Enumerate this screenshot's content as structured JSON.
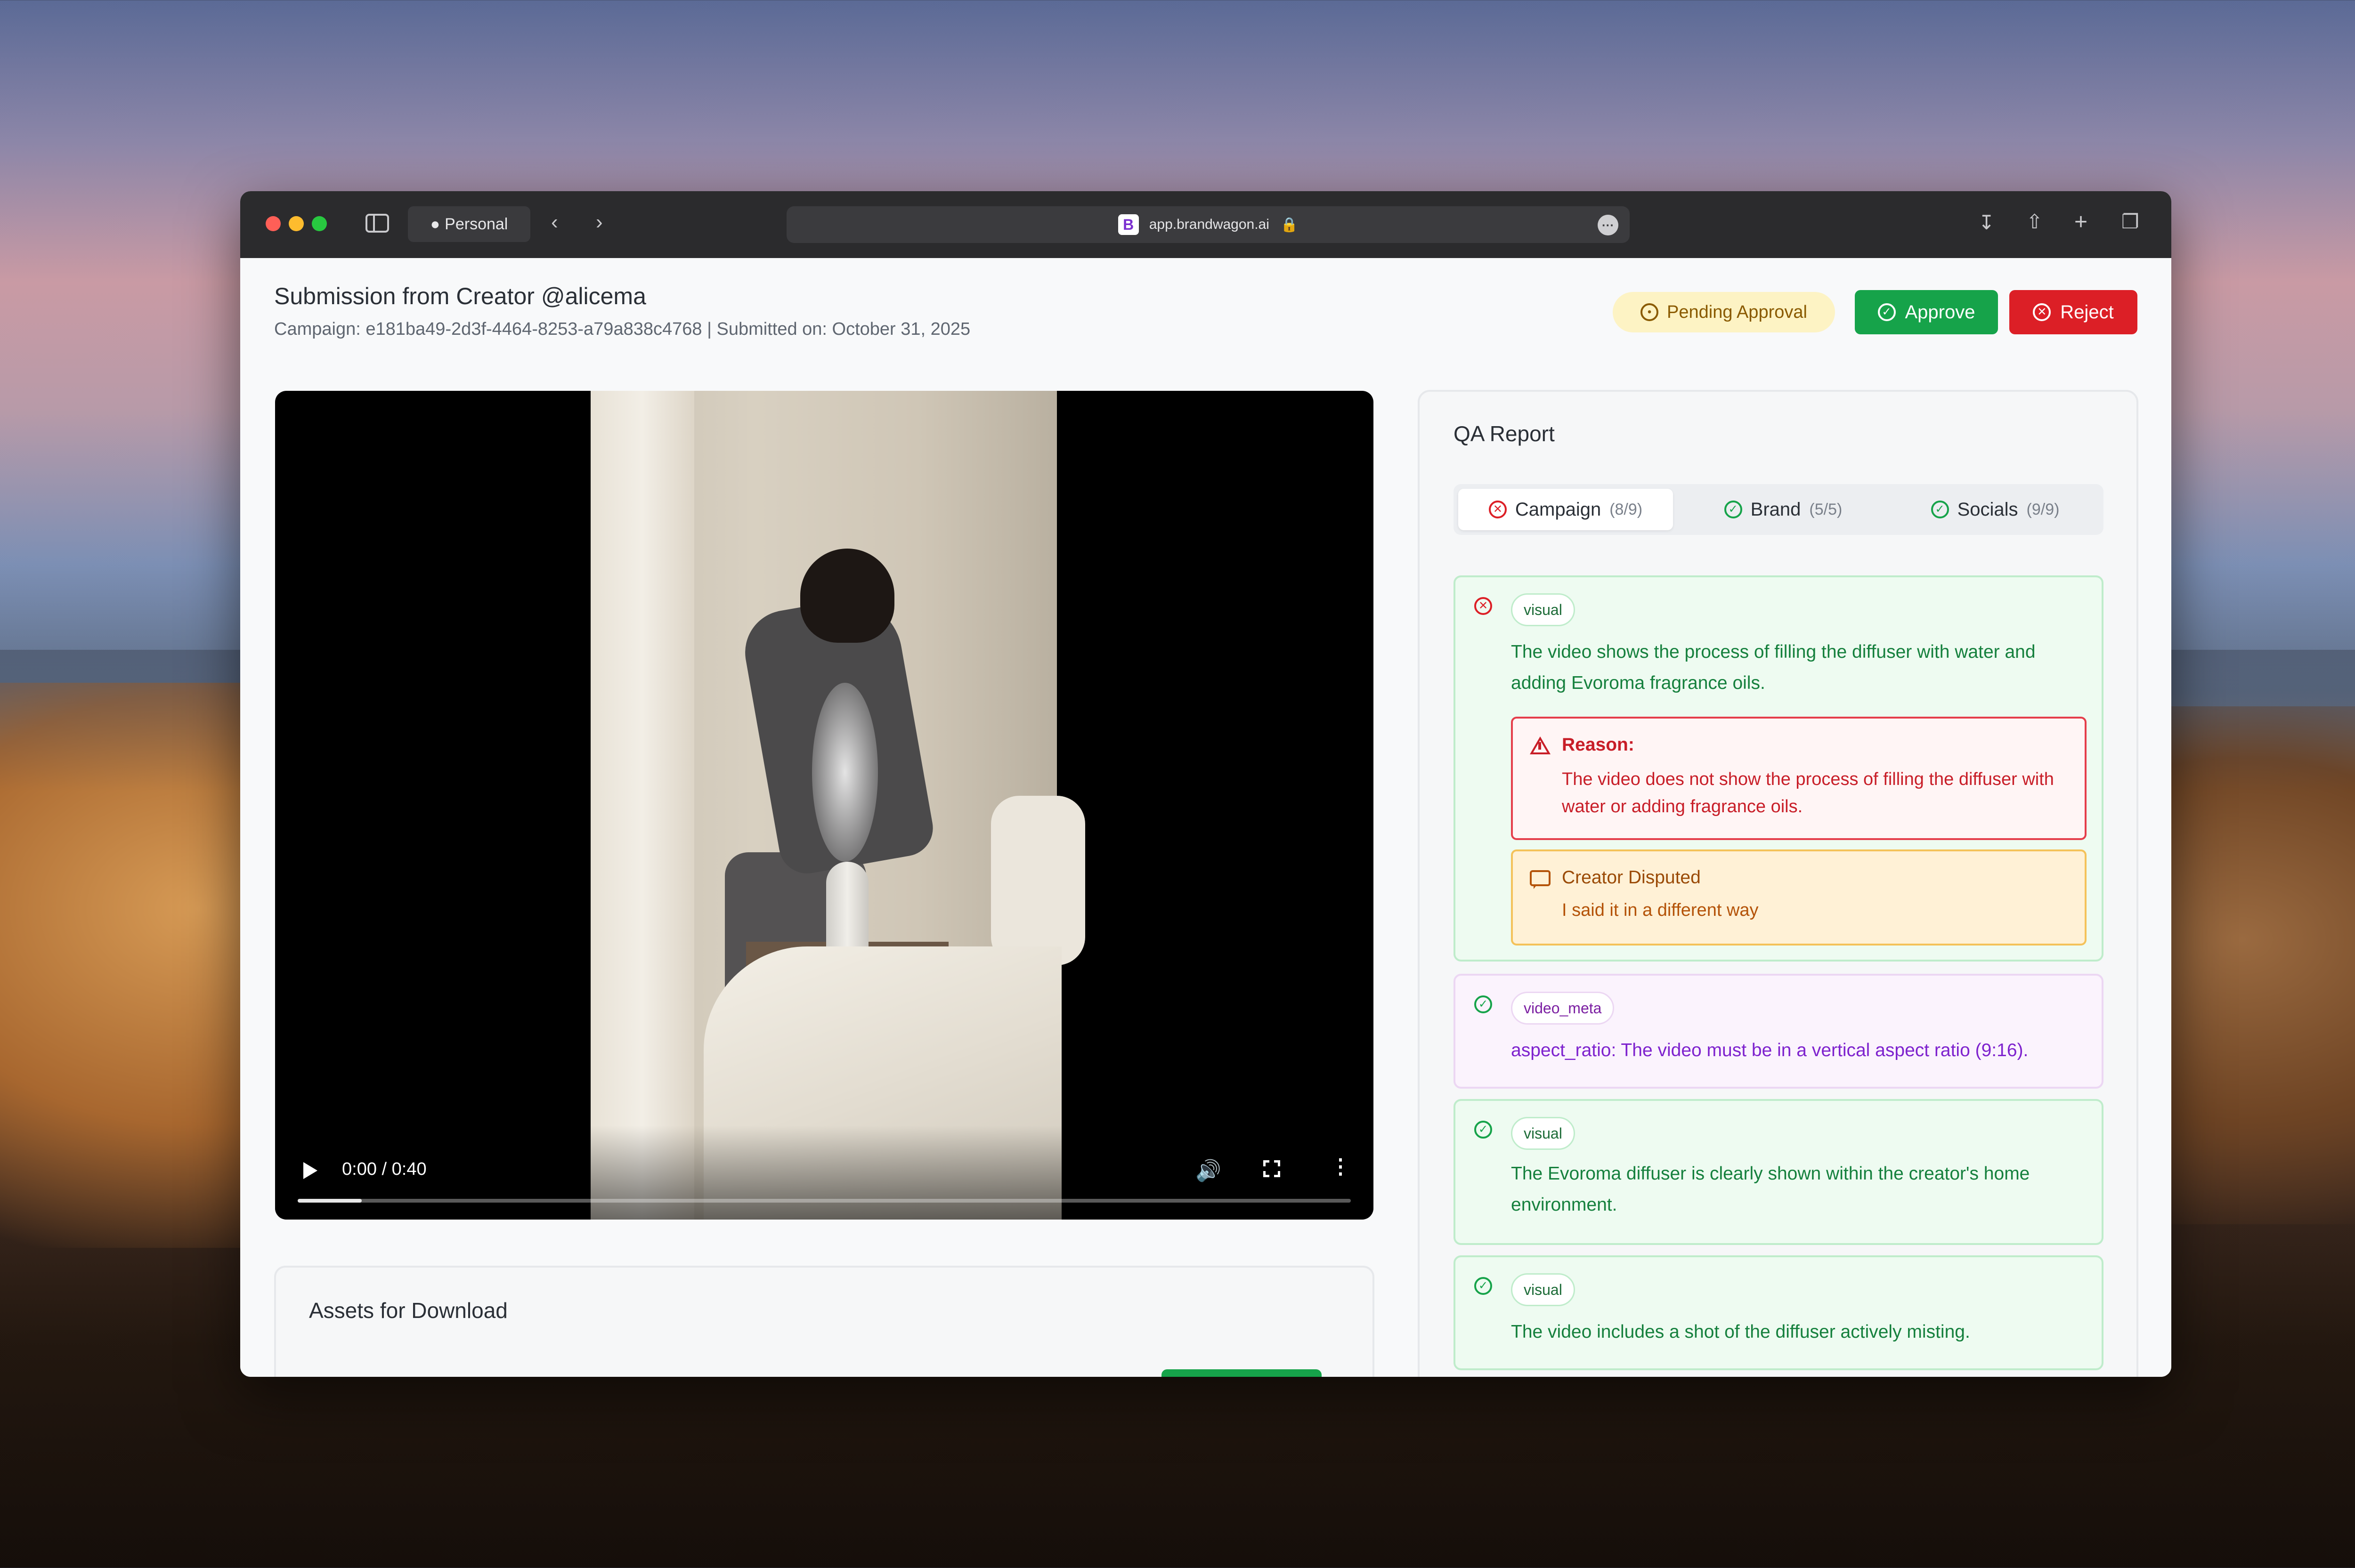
{
  "browser": {
    "profile_label": "Personal",
    "url": "app.brandwagon.ai",
    "favicon_letter": "B"
  },
  "header": {
    "title": "Submission from Creator @alicema",
    "subtitle": "Campaign: e181ba49-2d3f-4464-8253-a79a838c4768 | Submitted on: October 31, 2025",
    "status_badge": "Pending Approval",
    "approve_label": "Approve",
    "reject_label": "Reject"
  },
  "video": {
    "time": "0:00 / 0:40",
    "progress": 0.0
  },
  "assets": {
    "title": "Assets for Download"
  },
  "qa": {
    "title": "QA Report",
    "tabs": [
      {
        "label": "Campaign",
        "count": "(8/9)",
        "status": "fail"
      },
      {
        "label": "Brand",
        "count": "(5/5)",
        "status": "pass"
      },
      {
        "label": "Socials",
        "count": "(9/9)",
        "status": "pass"
      }
    ],
    "criteria": [
      {
        "status": "fail",
        "tag": "visual",
        "text": "The video shows the process of filling the diffuser with water and adding Evoroma fragrance oils.",
        "reason_label": "Reason:",
        "reason_text": "The video does not show the process of filling the diffuser with water or adding fragrance oils.",
        "dispute_label": "Creator Disputed",
        "dispute_text": "I said it in a different way"
      },
      {
        "status": "pass",
        "tag": "video_meta",
        "text": "aspect_ratio: The video must be in a vertical aspect ratio (9:16)."
      },
      {
        "status": "pass",
        "tag": "visual",
        "text": "The Evoroma diffuser is clearly shown within the creator's home environment."
      },
      {
        "status": "pass",
        "tag": "visual",
        "text": "The video includes a shot of the diffuser actively misting."
      }
    ]
  },
  "colors": {
    "approve": "#16a34a",
    "reject": "#dc1f26",
    "pending_bg": "#fdf3c4",
    "pass_bg": "#eefbf1",
    "meta_bg": "#fbf3fd"
  }
}
